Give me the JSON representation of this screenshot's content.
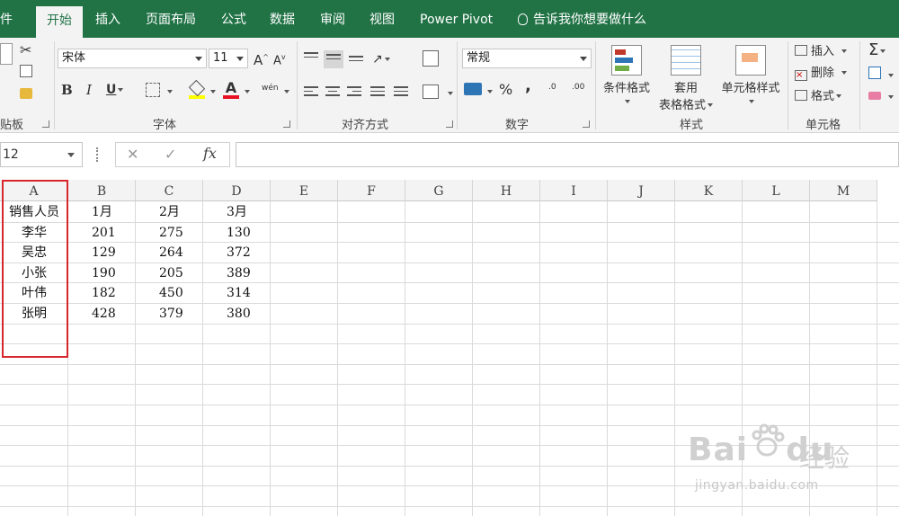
{
  "tabs": [
    {
      "label": "文件",
      "shown": "件"
    },
    {
      "label": "开始"
    },
    {
      "label": "插入"
    },
    {
      "label": "页面布局"
    },
    {
      "label": "公式"
    },
    {
      "label": "数据"
    },
    {
      "label": "审阅"
    },
    {
      "label": "视图"
    },
    {
      "label": "Power Pivot"
    }
  ],
  "tell_me": "告诉我你想要做什么",
  "ribbon": {
    "clipboard_label": "贴板",
    "font_group_label": "字体",
    "font_name": "宋体",
    "font_size": "11",
    "bold": "B",
    "italic": "I",
    "underline": "U",
    "font_color_glyph": "A",
    "grow_font": "A",
    "shrink_font": "A",
    "phonetic_glyph": "wén",
    "align_group_label": "对齐方式",
    "number_group_label": "数字",
    "number_format": "常规",
    "percent": "%",
    "comma": ",",
    "inc_decimal": ".0",
    "dec_decimal": ".00",
    "styles_group_label": "样式",
    "conditional_format": "条件格式",
    "format_as_table_1": "套用",
    "format_as_table_2": "表格格式",
    "cell_styles": "单元格样式",
    "cells_group_label": "单元格",
    "insert": "插入",
    "delete": "删除",
    "format": "格式",
    "sigma": "Σ"
  },
  "formula_bar": {
    "name_box": "12",
    "fx": "fx",
    "cancel": "✕",
    "enter": "✓",
    "value": ""
  },
  "columns": [
    "A",
    "B",
    "C",
    "D",
    "E",
    "F",
    "G",
    "H",
    "I",
    "J",
    "K",
    "L",
    "M"
  ],
  "rows": [
    [
      "销售人员",
      "1月",
      "2月",
      "3月"
    ],
    [
      "李华",
      "201",
      "275",
      "130"
    ],
    [
      "吴忠",
      "129",
      "264",
      "372"
    ],
    [
      "小张",
      "190",
      "205",
      "389"
    ],
    [
      "叶伟",
      "182",
      "450",
      "314"
    ],
    [
      "张明",
      "428",
      "379",
      "380"
    ]
  ],
  "watermark": {
    "brand": "Bai",
    "brand_tail": "du",
    "cn": "经验",
    "url": "jingyan.baidu.com"
  }
}
